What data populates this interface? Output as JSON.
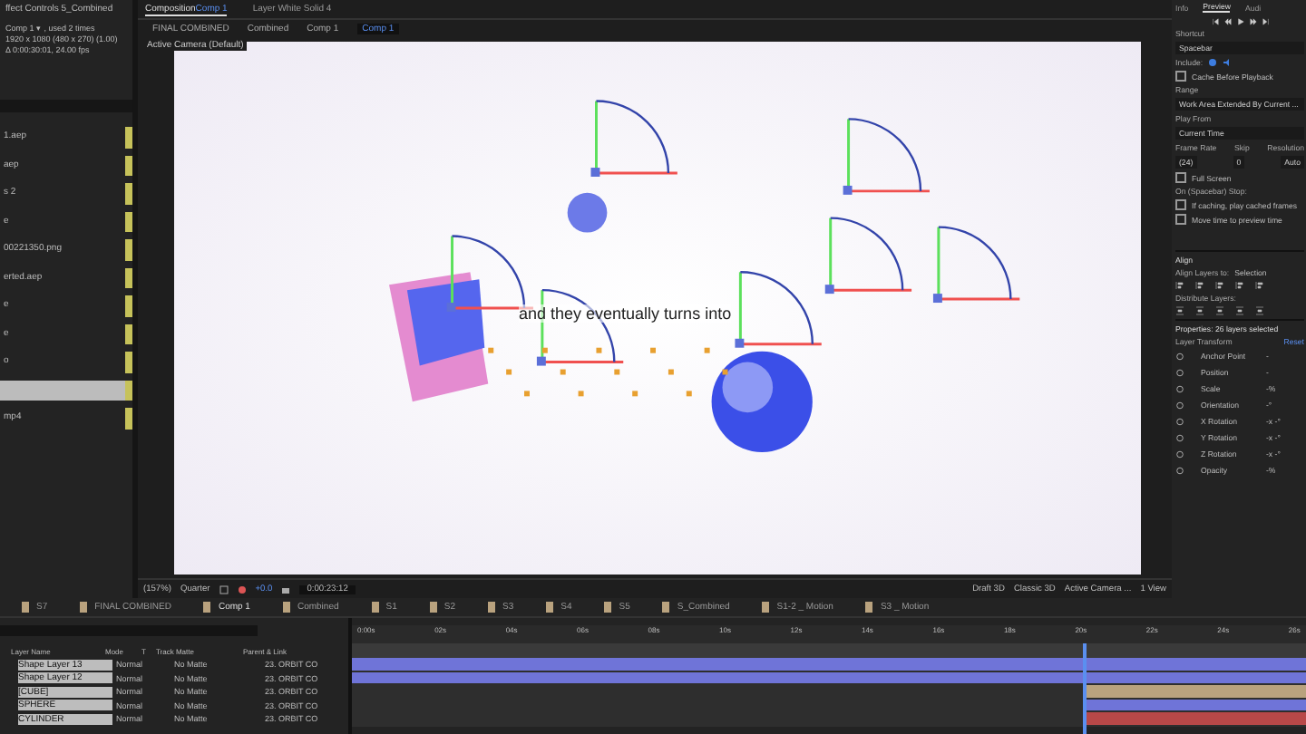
{
  "project": {
    "title": "ffect Controls 5_Combined",
    "info": [
      "Comp 1 ▾ , used 2 times",
      "1920 x 1080  (480 x 270) (1.00)",
      "Δ 0:00:30:01, 24.00 fps"
    ],
    "items": [
      {
        "label": "1.aep",
        "selected": false
      },
      {
        "label": "aep",
        "selected": false
      },
      {
        "label": "s 2",
        "selected": false
      },
      {
        "label": "e",
        "selected": false
      },
      {
        "label": "00221350.png",
        "selected": false
      },
      {
        "label": "erted.aep",
        "selected": false
      },
      {
        "label": "e",
        "selected": false
      },
      {
        "label": "e",
        "selected": false
      },
      {
        "label": "o",
        "selected": false
      },
      {
        "selected": true
      },
      {
        "label": "mp4",
        "selected": false
      }
    ]
  },
  "viewer": {
    "tabs": [
      {
        "label": "Composition",
        "comp": "Comp 1",
        "selected": true
      },
      {
        "label": "Layer White Solid 4",
        "selected": false
      }
    ],
    "breadcrumbs": [
      {
        "label": "FINAL COMBINED",
        "selected": false
      },
      {
        "label": "Combined",
        "selected": false
      },
      {
        "label": "Comp 1",
        "selected": false
      },
      {
        "label": "Comp 1",
        "selected": true
      }
    ],
    "camera_label": "Active Camera (Default)",
    "caption": "and they eventually turns into",
    "toolbar": {
      "zoom": "(157%)",
      "resolution": "Quarter",
      "exposure": "+0.0",
      "timecode": "0:00:23:12",
      "renderer_mode": "Draft 3D",
      "renderer": "Classic 3D",
      "camera": "Active Camera ...",
      "views": "1 View"
    }
  },
  "preview": {
    "tabs": [
      {
        "label": "Info",
        "selected": false
      },
      {
        "label": "Preview",
        "selected": true
      },
      {
        "label": "Audi",
        "selected": false
      }
    ],
    "shortcut_label": "Shortcut",
    "shortcut": "Spacebar",
    "include_label": "Include:",
    "cache": {
      "label": "Cache Before Playback",
      "checked": false
    },
    "range_label": "Range",
    "range": "Work Area Extended By Current ...",
    "play_from_label": "Play From",
    "play_from": "Current Time",
    "frame_rate_label": "Frame Rate",
    "skip_label": "Skip",
    "resolution_label": "Resolution",
    "frame_rate": "(24)",
    "skip": "0",
    "resolution": "Auto",
    "full_screen": {
      "label": "Full Screen",
      "checked": false
    },
    "stop_label": "On (Spacebar) Stop:",
    "stop_options": [
      {
        "label": "If caching, play cached frames",
        "checked": false
      },
      {
        "label": "Move time to preview time",
        "checked": false
      }
    ]
  },
  "align": {
    "title": "Align",
    "align_to_label": "Align Layers to:",
    "align_to": "Selection",
    "distribute_label": "Distribute Layers:"
  },
  "properties": {
    "title": "Properties: 26 layers selected",
    "section": "Layer Transform",
    "reset": "Reset",
    "rows": [
      {
        "label": "Anchor Point",
        "value": "-"
      },
      {
        "label": "Position",
        "value": "-"
      },
      {
        "label": "Scale",
        "value": "-%"
      },
      {
        "label": "Orientation",
        "value": "-°"
      },
      {
        "label": "X Rotation",
        "value": "-x -°"
      },
      {
        "label": "Y Rotation",
        "value": "-x -°"
      },
      {
        "label": "Z Rotation",
        "value": "-x -°"
      },
      {
        "label": "Opacity",
        "value": "-%"
      }
    ]
  },
  "timeline": {
    "tabs": [
      {
        "label": "S7",
        "selected": false
      },
      {
        "label": "FINAL COMBINED",
        "selected": false
      },
      {
        "label": "Comp 1",
        "selected": true
      },
      {
        "label": "Combined",
        "selected": false
      },
      {
        "label": "S1",
        "selected": false
      },
      {
        "label": "S2",
        "selected": false
      },
      {
        "label": "S3",
        "selected": false
      },
      {
        "label": "S4",
        "selected": false
      },
      {
        "label": "S5",
        "selected": false
      },
      {
        "label": "S_Combined",
        "selected": false
      },
      {
        "label": "S1-2 _ Motion",
        "selected": false
      },
      {
        "label": "S3 _ Motion",
        "selected": false
      }
    ],
    "columns": [
      "Layer Name",
      "Mode",
      "T",
      "Track Matte",
      "Parent & Link"
    ],
    "ruler": [
      "0:00s",
      "02s",
      "04s",
      "06s",
      "08s",
      "10s",
      "12s",
      "14s",
      "16s",
      "18s",
      "20s",
      "22s",
      "24s",
      "26s"
    ],
    "playhead": {
      "level": 0.77
    },
    "layers": [
      {
        "name": "Shape Layer 13",
        "mode": "Normal",
        "matte": "No Matte",
        "parent": "23. ORBIT CO",
        "color": "#6f74d8",
        "kind": "full"
      },
      {
        "name": "Shape Layer 12",
        "mode": "Normal",
        "matte": "No Matte",
        "parent": "23. ORBIT CO",
        "color": "#6f74d8",
        "kind": "full"
      },
      {
        "name": "[CUBE]",
        "mode": "Normal",
        "matte": "No Matte",
        "parent": "23. ORBIT CO",
        "color": "#b9a27e",
        "kind": "late"
      },
      {
        "name": "SPHERE",
        "mode": "Normal",
        "matte": "No Matte",
        "parent": "23. ORBIT CO",
        "color": "#6f74d8",
        "kind": "late"
      },
      {
        "name": "CYLINDER",
        "mode": "Normal",
        "matte": "No Matte",
        "parent": "23. ORBIT CO",
        "color": "#b84848",
        "kind": "late"
      }
    ]
  }
}
